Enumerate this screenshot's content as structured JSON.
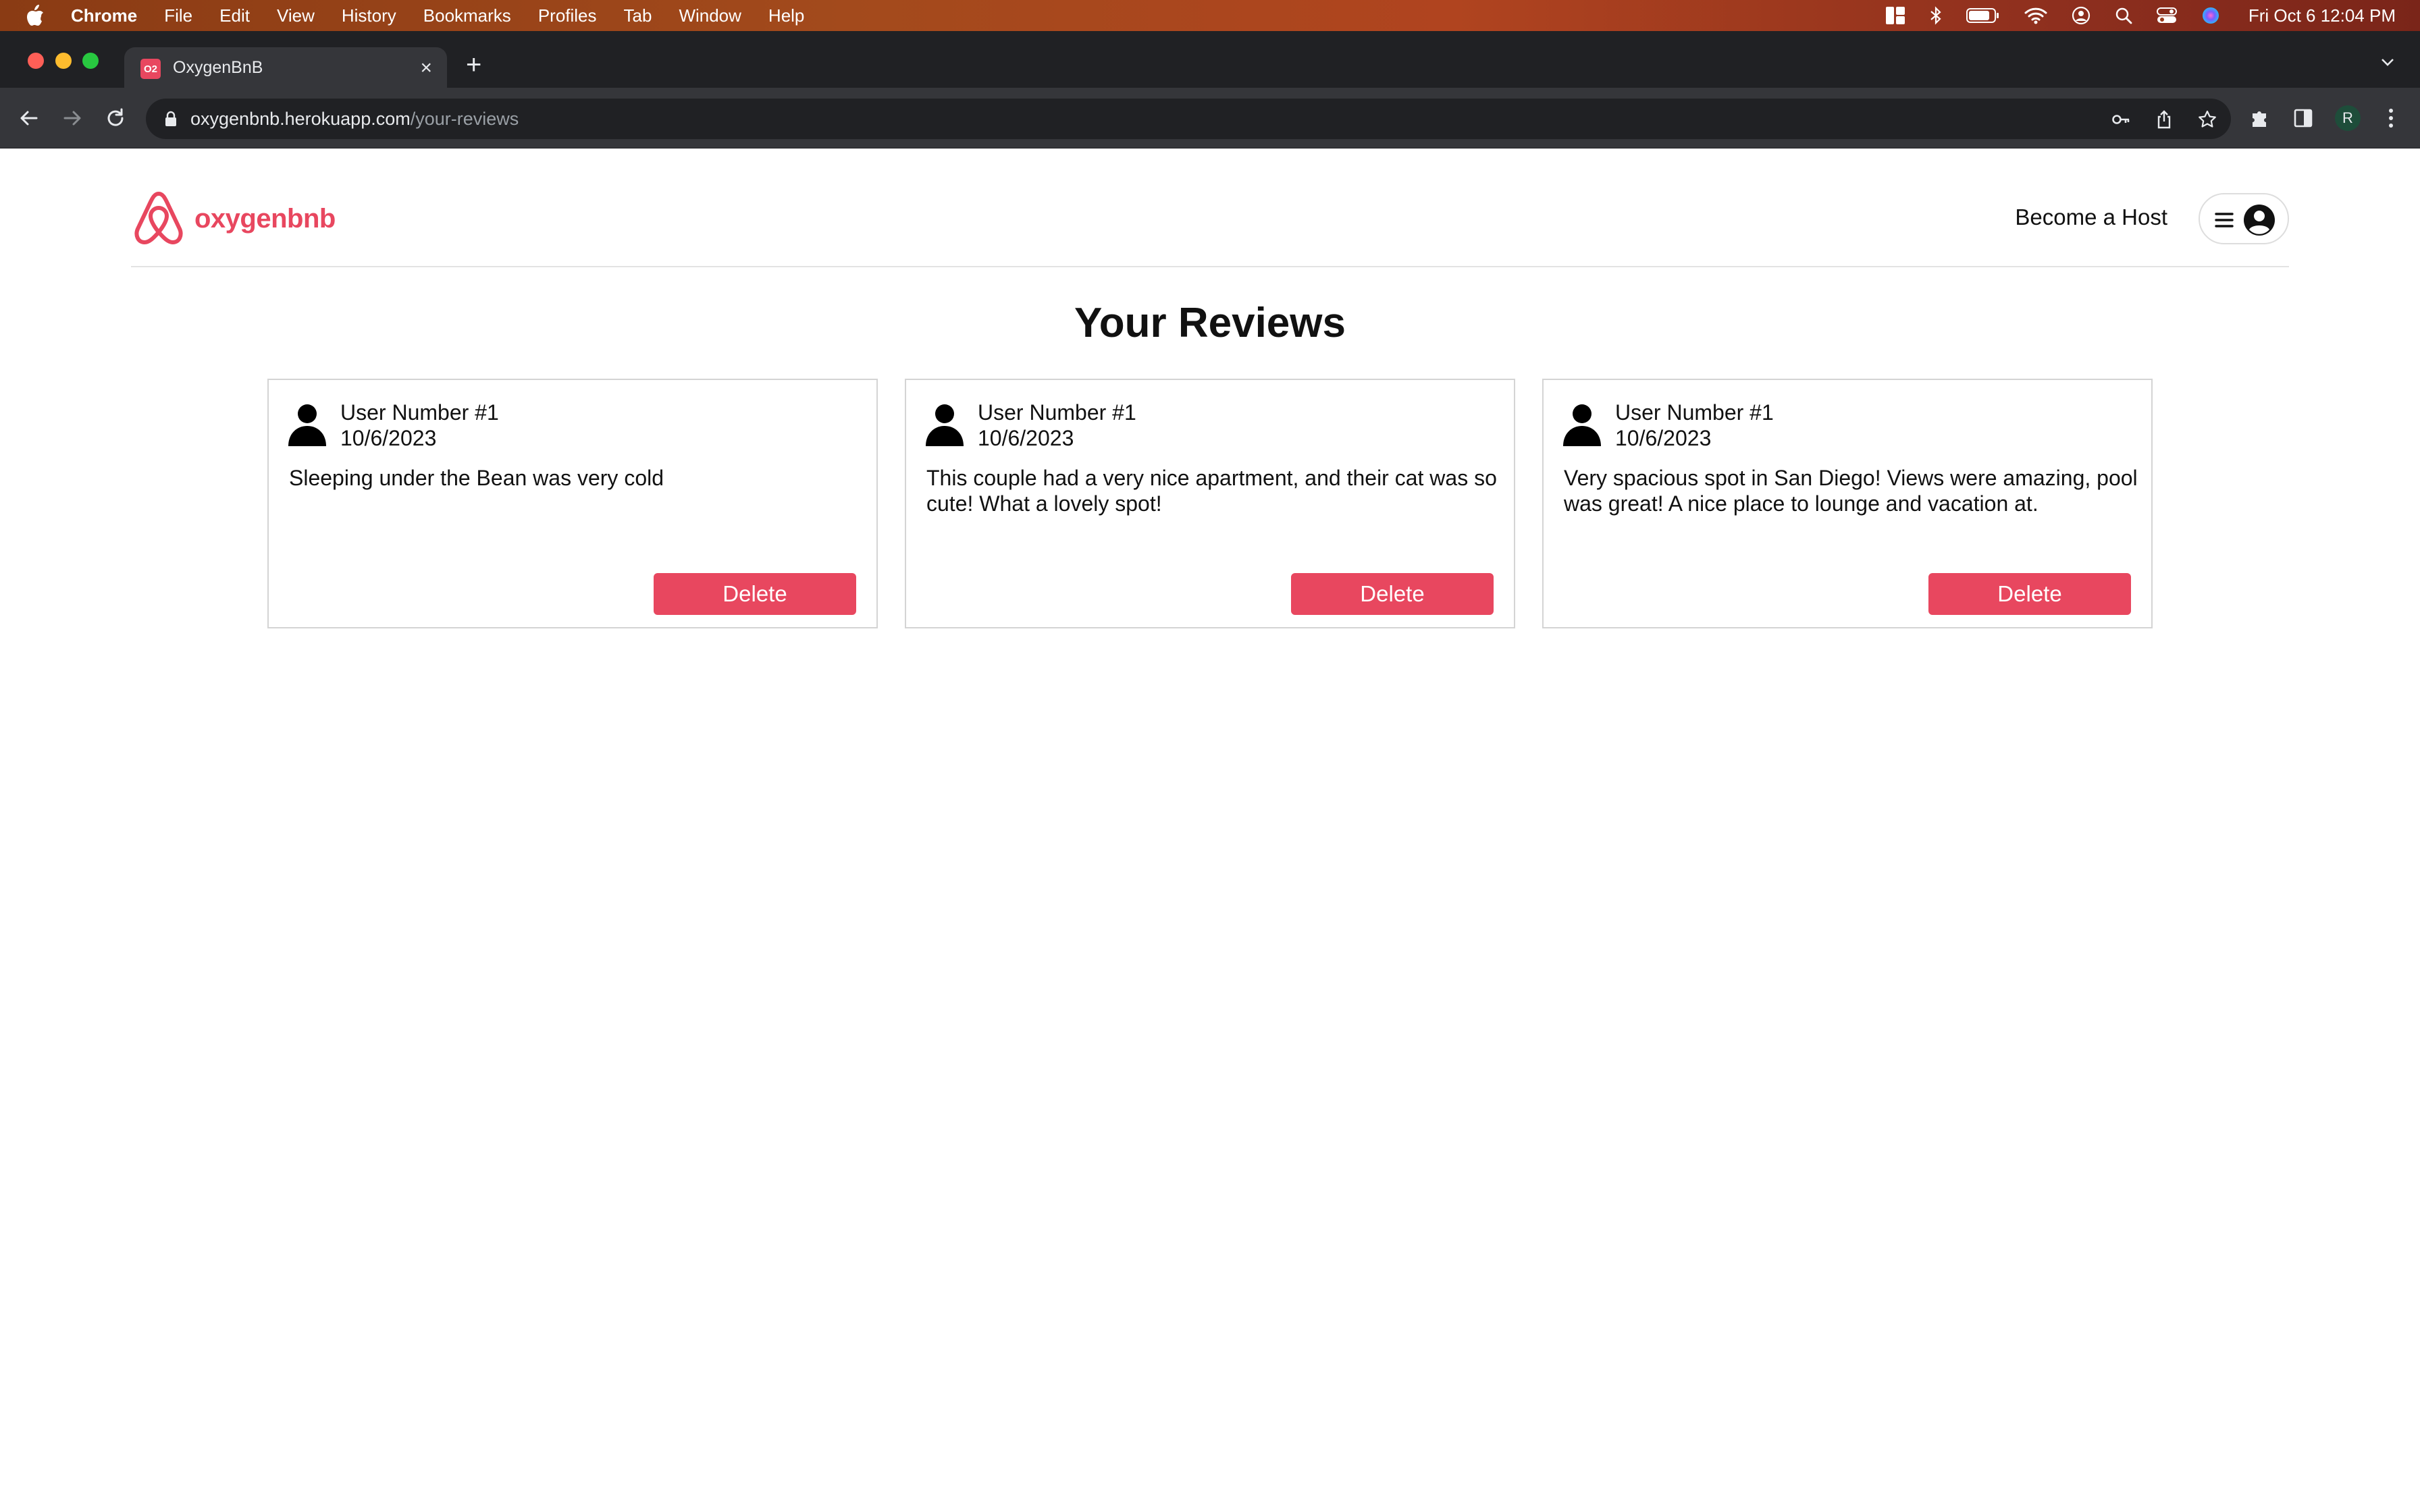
{
  "menubar": {
    "app": "Chrome",
    "menus": [
      "File",
      "Edit",
      "View",
      "History",
      "Bookmarks",
      "Profiles",
      "Tab",
      "Window",
      "Help"
    ],
    "clock": "Fri Oct 6  12:04 PM"
  },
  "browser": {
    "tab": {
      "favicon_text": "O2",
      "title": "OxygenBnB"
    },
    "url_host": "oxygenbnb.herokuapp.com",
    "url_path": "/your-reviews",
    "profile_initial": "R"
  },
  "header": {
    "brand": "oxygenbnb",
    "host_link": "Become a Host"
  },
  "page": {
    "title": "Your Reviews"
  },
  "reviews": [
    {
      "user": "User Number #1",
      "date": "10/6/2023",
      "text": "Sleeping under the Bean was very cold",
      "delete_label": "Delete"
    },
    {
      "user": "User Number #1",
      "date": "10/6/2023",
      "text": "This couple had a very nice apartment, and their cat was so cute! What a lovely spot!",
      "delete_label": "Delete"
    },
    {
      "user": "User Number #1",
      "date": "10/6/2023",
      "text": "Very spacious spot in San Diego! Views were amazing, pool was great! A nice place to lounge and vacation at.",
      "delete_label": "Delete"
    }
  ],
  "colors": {
    "brand": "#e8475f",
    "tabstrip": "#202124",
    "toolbar": "#35363a"
  },
  "icons": [
    "apple-icon",
    "bluetooth-icon",
    "battery-icon",
    "wifi-icon",
    "search-icon",
    "control-center-icon",
    "siri-icon",
    "lock-icon",
    "key-icon",
    "share-icon",
    "star-icon",
    "puzzle-icon",
    "sidepanel-icon",
    "hamburger-icon",
    "user-avatar-icon",
    "person-icon"
  ]
}
